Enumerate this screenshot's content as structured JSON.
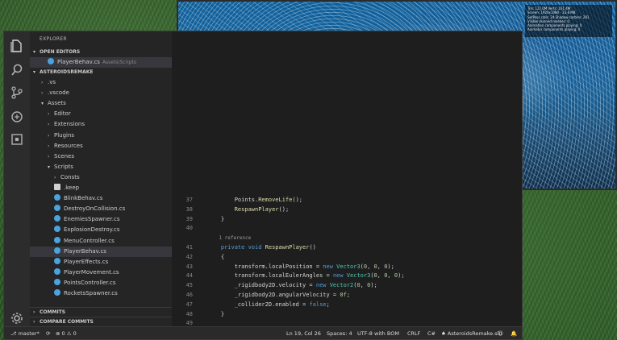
{
  "colors": {
    "editor_bg": "#1e1e1e",
    "sidebar_bg": "#252526",
    "keyword": "#569cd6",
    "function": "#dcdcaa",
    "type": "#4ec9b0",
    "number": "#b5cea8"
  },
  "activity_icons": [
    "files-icon",
    "search-icon",
    "source-control-icon",
    "debug-icon",
    "extensions-icon",
    "gear-icon"
  ],
  "explorer": {
    "title": "EXPLORER",
    "open_editors_label": "OPEN EDITORS",
    "open_editor_item": "PlayerBehav.cs",
    "open_editor_hint": "Assets\\Scripts",
    "project_label": "ASTEROIDSREMAKE",
    "tree": [
      {
        "label": ".vs",
        "kind": "folder",
        "state": "collapsed"
      },
      {
        "label": ".vscode",
        "kind": "folder",
        "state": "collapsed"
      },
      {
        "label": "Assets",
        "kind": "folder",
        "state": "expanded"
      },
      {
        "label": "Editor",
        "kind": "folder",
        "state": "collapsed"
      },
      {
        "label": "Extensions",
        "kind": "folder",
        "state": "collapsed"
      },
      {
        "label": "Plugins",
        "kind": "folder",
        "state": "collapsed"
      },
      {
        "label": "Resources",
        "kind": "folder",
        "state": "collapsed"
      },
      {
        "label": "Scenes",
        "kind": "folder",
        "state": "collapsed"
      },
      {
        "label": "Scripts",
        "kind": "folder",
        "state": "expanded"
      },
      {
        "label": "Consts",
        "kind": "folder",
        "state": "collapsed"
      },
      {
        "label": ".keep",
        "kind": "file"
      },
      {
        "label": "BlinkBehav.cs",
        "kind": "cs"
      },
      {
        "label": "DestroyOnCollision.cs",
        "kind": "cs"
      },
      {
        "label": "EnemiesSpawner.cs",
        "kind": "cs"
      },
      {
        "label": "ExplosionDestroy.cs",
        "kind": "cs"
      },
      {
        "label": "MenuController.cs",
        "kind": "cs"
      },
      {
        "label": "PlayerBehav.cs",
        "kind": "cs",
        "active": true
      },
      {
        "label": "PlayerEffects.cs",
        "kind": "cs"
      },
      {
        "label": "PlayerMovement.cs",
        "kind": "cs"
      },
      {
        "label": "PointsController.cs",
        "kind": "cs"
      },
      {
        "label": "RocketsSpawner.cs",
        "kind": "cs"
      }
    ],
    "commits_label": "COMMITS",
    "compare_commits_label": "COMPARE COMMITS"
  },
  "editor": {
    "lines": [
      {
        "n": "37",
        "t": [
          [
            "op",
            "        Points."
          ],
          [
            "fn",
            "RemoveLife"
          ],
          [
            "op",
            "();"
          ]
        ]
      },
      {
        "n": "38",
        "t": [
          [
            "op",
            "        "
          ],
          [
            "fn",
            "RespawnPlayer"
          ],
          [
            "op",
            "();"
          ]
        ]
      },
      {
        "n": "39",
        "t": [
          [
            "op",
            "    }"
          ]
        ]
      },
      {
        "n": "40",
        "t": []
      },
      {
        "n": "",
        "lens": "1 reference"
      },
      {
        "n": "41",
        "t": [
          [
            "kw",
            "    private void "
          ],
          [
            "fn",
            "RespawnPlayer"
          ],
          [
            "op",
            "()"
          ]
        ]
      },
      {
        "n": "42",
        "t": [
          [
            "op",
            "    {"
          ]
        ]
      },
      {
        "n": "43",
        "t": [
          [
            "op",
            "        transform.localPosition = "
          ],
          [
            "kw",
            "new "
          ],
          [
            "ty",
            "Vector3"
          ],
          [
            "op",
            "("
          ],
          [
            "nm",
            "0"
          ],
          [
            "op",
            ", "
          ],
          [
            "nm",
            "0"
          ],
          [
            "op",
            ", "
          ],
          [
            "nm",
            "0"
          ],
          [
            "op",
            ");"
          ]
        ]
      },
      {
        "n": "44",
        "t": [
          [
            "op",
            "        transform.localEulerAngles = "
          ],
          [
            "kw",
            "new "
          ],
          [
            "ty",
            "Vector3"
          ],
          [
            "op",
            "("
          ],
          [
            "nm",
            "0"
          ],
          [
            "op",
            ", "
          ],
          [
            "nm",
            "0"
          ],
          [
            "op",
            ", "
          ],
          [
            "nm",
            "0"
          ],
          [
            "op",
            ");"
          ]
        ]
      },
      {
        "n": "45",
        "t": [
          [
            "op",
            "        _rigidbody2D.velocity = "
          ],
          [
            "kw",
            "new "
          ],
          [
            "ty",
            "Vector2"
          ],
          [
            "op",
            "("
          ],
          [
            "nm",
            "0"
          ],
          [
            "op",
            ", "
          ],
          [
            "nm",
            "0"
          ],
          [
            "op",
            ");"
          ]
        ]
      },
      {
        "n": "46",
        "t": [
          [
            "op",
            "        _rigidbody2D.angularVelocity = "
          ],
          [
            "nm",
            "0f"
          ],
          [
            "op",
            ";"
          ]
        ]
      },
      {
        "n": "47",
        "t": [
          [
            "op",
            "        _collider2D.enabled = "
          ],
          [
            "kw",
            "false"
          ],
          [
            "op",
            ";"
          ]
        ]
      },
      {
        "n": "48",
        "t": [
          [
            "op",
            "    }"
          ]
        ]
      },
      {
        "n": "49",
        "t": []
      }
    ]
  },
  "statusbar": {
    "branch": "master*",
    "sync": "⟳",
    "errors": "0",
    "warnings": "0",
    "position": "Ln 19, Col 26",
    "spaces": "Spaces: 4",
    "encoding": "UTF-8 with BOM",
    "eol": "CRLF",
    "language": "C#",
    "solution": "AsteroidsRemake.sln"
  },
  "game_stats": [
    "Tris: 122.0M    Verts: 161.4M",
    "Screen: 1920x1080 - 23.8 MB",
    "SetPass calls: 24     Shadow casters: 281",
    "Visible skinned meshes: 0",
    "Animation components playing: 0",
    "Animator components playing: 0"
  ]
}
